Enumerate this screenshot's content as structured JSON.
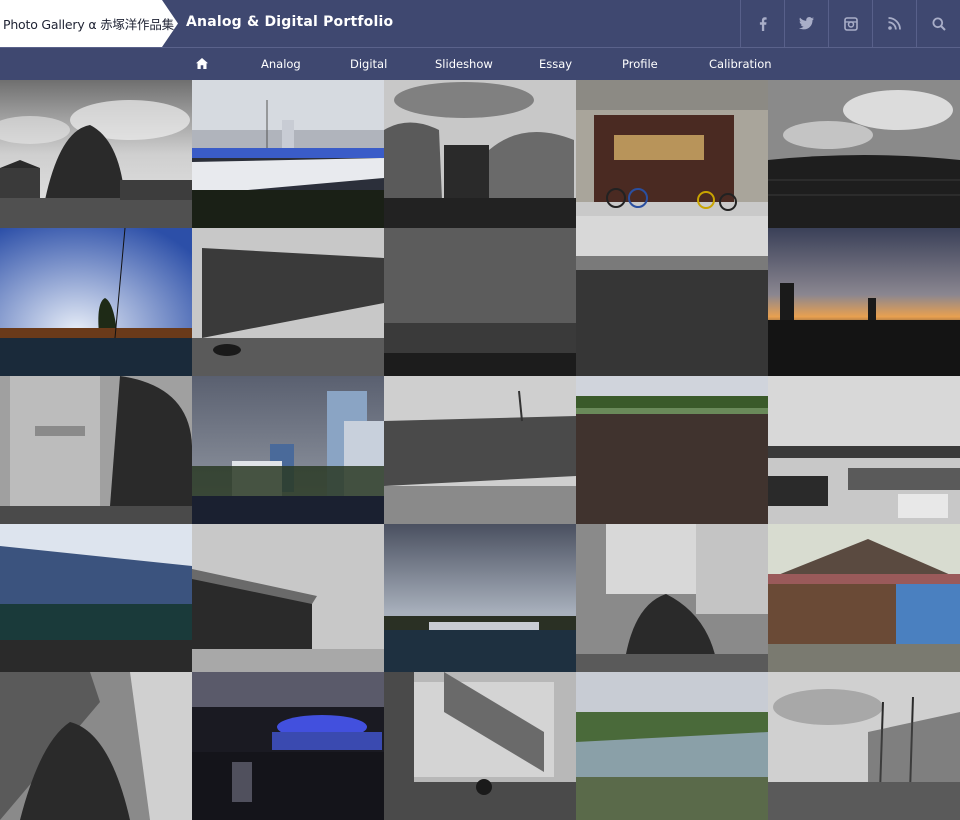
{
  "header": {
    "brand_text": "Photo Gallery α 赤塚洋作品集",
    "site_title": "Analog & Digital Portfolio",
    "social": [
      {
        "icon": "facebook-icon"
      },
      {
        "icon": "twitter-icon"
      },
      {
        "icon": "instagram-icon"
      },
      {
        "icon": "rss-icon"
      },
      {
        "icon": "search-icon"
      }
    ]
  },
  "nav": {
    "home_icon": "home-icon",
    "items": [
      "Analog",
      "Digital",
      "Slideshow",
      "Essay",
      "Profile",
      "Calibration"
    ]
  },
  "colors": {
    "header_bg": "#3f4870",
    "brand_bg": "#ffffff",
    "text_light": "#ffffff"
  },
  "gallery": {
    "tiles": [
      {
        "subject": "bw-trees-under-clouds"
      },
      {
        "subject": "greenhouse-field-with-buildings"
      },
      {
        "subject": "bw-greenhouses"
      },
      {
        "subject": "garage-with-bicycles"
      },
      {
        "subject": "bw-greenhouse-roof-clouds"
      },
      {
        "subject": "blue-sky-streaks-fence"
      },
      {
        "subject": "bw-mesh-fence"
      },
      {
        "subject": "bw-concrete-wall"
      },
      {
        "subject": "bw-dirt-field"
      },
      {
        "subject": "city-skyline-sunset"
      },
      {
        "subject": "bw-apartment-stairs"
      },
      {
        "subject": "office-tower-cloudy"
      },
      {
        "subject": "bw-mesh-fence-tower"
      },
      {
        "subject": "sports-field-dirt"
      },
      {
        "subject": "bw-parking-lot"
      },
      {
        "subject": "blue-net-fence"
      },
      {
        "subject": "bw-warehouse-street"
      },
      {
        "subject": "cloudy-greenhouse-field"
      },
      {
        "subject": "bw-stairs-plant"
      },
      {
        "subject": "old-shed-blue-door"
      },
      {
        "subject": "bw-alley-shadow"
      },
      {
        "subject": "night-canal-blue-light"
      },
      {
        "subject": "bw-apartment-motorbike"
      },
      {
        "subject": "tennis-court-park"
      },
      {
        "subject": "bw-field-poles-nets"
      }
    ]
  }
}
